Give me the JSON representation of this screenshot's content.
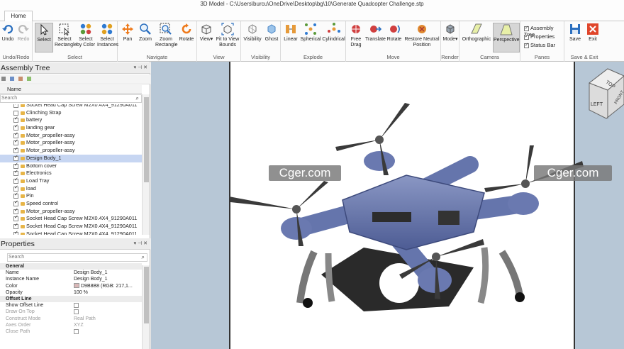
{
  "window_title": "3D Model - C:\\Users\\burcu\\OneDrive\\Desktop\\bg\\10\\Generate Quadcopter Challenge.stp",
  "tab_home": "Home",
  "ribbon": {
    "undo": "Undo",
    "redo": "Redo",
    "group_undo": "Undo/Redo",
    "select": "Select",
    "select_rect": "Select\nRectangle",
    "select_color": "Select\nby Color",
    "select_instances": "Select\nInstances",
    "group_select": "Select",
    "pan": "Pan",
    "zoom": "Zoom",
    "zoom_rect": "Zoom\nRectangle",
    "rotate": "Rotate",
    "group_navigate": "Navigate",
    "view": "View",
    "fit_view": "Fit to View\nBounds",
    "group_view": "View",
    "visibility": "Visibility",
    "ghost": "Ghost",
    "group_visibility": "Visibility",
    "linear": "Linear",
    "spherical": "Spherical",
    "cylindrical": "Cylindrical",
    "group_explode": "Explode",
    "free_drag": "Free\nDrag",
    "translate": "Translate",
    "rotate_move": "Rotate",
    "restore": "Restore Neutral\nPosition",
    "group_move": "Move",
    "mode": "Mode",
    "group_render": "Render",
    "orthographic": "Orthographic",
    "perspective": "Perspective",
    "group_camera": "Camera",
    "assembly_tree": "Assembly Tree",
    "properties": "Properties",
    "status_bar": "Status Bar",
    "group_panes": "Panes",
    "save": "Save",
    "exit": "Exit",
    "group_save": "Save & Exit"
  },
  "assembly_tree": {
    "title": "Assembly Tree",
    "column_name": "Name",
    "search_placeholder": "Search",
    "items": [
      {
        "label": "Socket Head Cap Screw M2X0.4X4_91290A011",
        "checked": true
      },
      {
        "label": "Clinching Strap",
        "checked": false
      },
      {
        "label": "battery",
        "checked": true
      },
      {
        "label": "landing gear",
        "checked": true
      },
      {
        "label": "Motor_propeller-assy",
        "checked": true
      },
      {
        "label": "Motor_propeller-assy",
        "checked": true
      },
      {
        "label": "Motor_propeller-assy",
        "checked": true
      },
      {
        "label": "Design Body_1",
        "checked": true,
        "selected": true
      },
      {
        "label": "Bottom cover",
        "checked": true
      },
      {
        "label": "Electronics",
        "checked": true
      },
      {
        "label": "Load Tray",
        "checked": true
      },
      {
        "label": "load",
        "checked": true
      },
      {
        "label": "Pin",
        "checked": true
      },
      {
        "label": "Speed control",
        "checked": true
      },
      {
        "label": "Motor_propeller-assy",
        "checked": true
      },
      {
        "label": "Socket Head Cap Screw M2X0.4X4_91290A011",
        "checked": true
      },
      {
        "label": "Socket Head Cap Screw M2X0.4X4_91290A011",
        "checked": true
      },
      {
        "label": "Socket Head Cap Screw M2X0.4X4_91290A011",
        "checked": true
      }
    ]
  },
  "properties": {
    "title": "Properties",
    "search_placeholder": "Search",
    "general": "General",
    "name_k": "Name",
    "name_v": "Design Body_1",
    "instance_k": "Instance Name",
    "instance_v": "Design Body_1",
    "color_k": "Color",
    "color_v": "D9B8B8 (RGB: 217,1...",
    "opacity_k": "Opacity",
    "opacity_v": "100 %",
    "offset_line": "Offset Line",
    "show_offset_k": "Show Offset Line",
    "draw_on_top_k": "Draw On Top",
    "construct_k": "Construct Mode",
    "construct_v": "Real Path",
    "axes_k": "Axes Order",
    "axes_v": "XYZ",
    "close_k": "Close Path"
  },
  "viewcube": {
    "top": "TOP",
    "left": "LEFT",
    "front": "FRONT"
  },
  "watermark": "Cger.com",
  "colors": {
    "selection": "#c7d6f2",
    "viewport_bg": "#b7c7d6",
    "drone_body": "#5d6fa8",
    "swatch": "#d9b8b8"
  }
}
